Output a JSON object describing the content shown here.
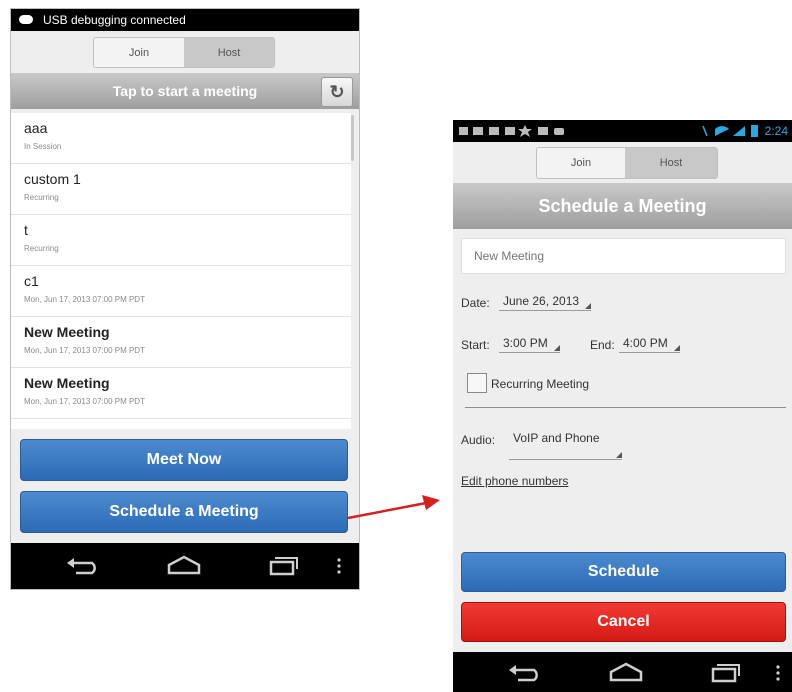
{
  "phone1": {
    "status_text": "USB debugging connected",
    "tabs": {
      "join": "Join",
      "host": "Host"
    },
    "banner": "Tap to start a meeting",
    "meetings": [
      {
        "name": "aaa",
        "sub": "In Session"
      },
      {
        "name": "custom 1",
        "sub": "Recurring"
      },
      {
        "name": "t",
        "sub": "Recurring"
      },
      {
        "name": "c1",
        "sub": "Mon, Jun 17, 2013 07:00 PM PDT"
      },
      {
        "name": "New Meeting",
        "sub": "Mon, Jun 17, 2013 07:00 PM PDT"
      },
      {
        "name": "New Meeting",
        "sub": "Mon, Jun 17, 2013 07:00 PM PDT"
      }
    ],
    "meet_now": "Meet Now",
    "schedule": "Schedule a Meeting"
  },
  "phone2": {
    "time": "2:24",
    "tabs": {
      "join": "Join",
      "host": "Host"
    },
    "header": "Schedule a Meeting",
    "meeting_name_placeholder": "New Meeting",
    "date_label": "Date:",
    "date_value": "June 26, 2013",
    "start_label": "Start:",
    "start_value": "3:00 PM",
    "end_label": "End:",
    "end_value": "4:00 PM",
    "recurring_label": "Recurring Meeting",
    "audio_label": "Audio:",
    "audio_value": "VoIP and Phone",
    "edit_phone": "Edit phone numbers",
    "schedule_btn": "Schedule",
    "cancel_btn": "Cancel"
  },
  "colors": {
    "blue": "#2b6bb5",
    "red": "#d41a14",
    "arrow": "#d42222"
  }
}
